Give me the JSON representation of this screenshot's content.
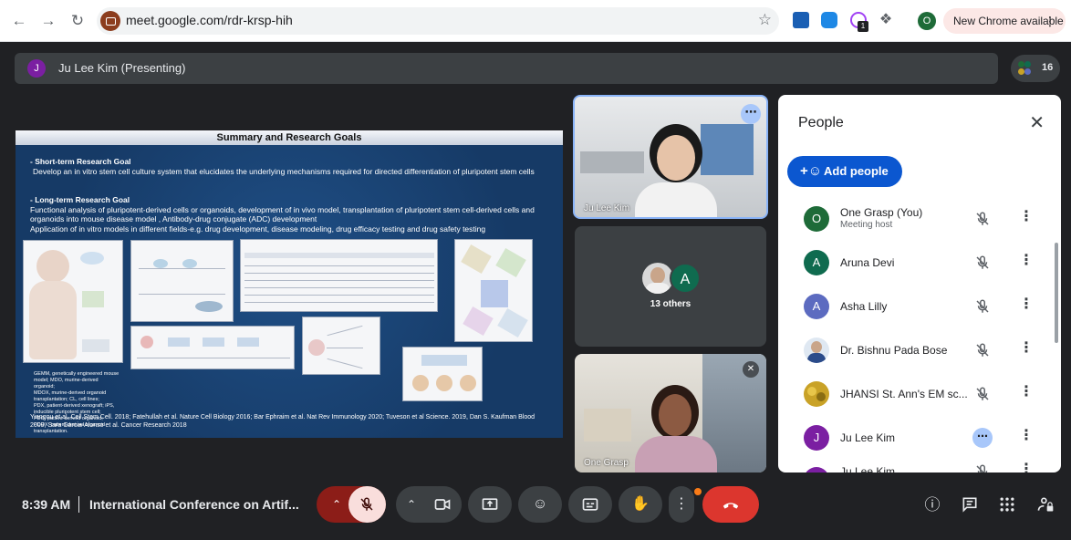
{
  "browser": {
    "url": "meet.google.com/rdr-krsp-hih",
    "profile_initial": "O",
    "update_label": "New Chrome available",
    "extension_badge": "1"
  },
  "meet": {
    "presenter_label": "Ju Lee Kim (Presenting)",
    "presenter_initial": "J",
    "participant_count": "16"
  },
  "slide": {
    "title": "Summary and Research Goals",
    "short_term_heading": "- Short-term Research Goal",
    "short_term_body": "Develop an in vitro stem cell culture system that elucidates the underlying mechanisms required for directed differentiation of pluripotent stem cells",
    "long_term_heading": "- Long-term Research Goal",
    "long_term_body": "Functional analysis of pluripotent-derived cells or organoids, development of  in vivo model, transplantation of pluripotent stem cell-derived cells and organoids into mouse disease model , Antibody-drug conjugate (ADC) development",
    "application": "Application of in vitro models in different fields-e.g. drug development, disease modeling, drug efficacy testing and drug safety testing",
    "abbrev": [
      "GEMM, genetically engineered mouse model; MDO, murine-derived",
      "organoid;",
      "MDOX, murine-derived organoid transplantation; CL, cell lines;",
      "PDX, patient-derived xenograft; iPS, inducible pluripotent stem cell;",
      "PDO, patient-derived organoid;",
      "PDOX, patient-derived organoid transplantation."
    ],
    "references": "Yiangou et al. Cell Stem Cell. 2018; Fatehullah et al. Nature Cell Biology 2016; Bar Ephraim et al.  Nat Rev Immunology 2020; Tuveson et al Science. 2019, Dan S. Kaufman Blood 2009, Sara Garcia-Alonso  et al. Cancer Research 2018"
  },
  "tiles": {
    "speaker_name": "Ju Lee Kim",
    "others_initial": "A",
    "others_label": "13 others",
    "self_name": "One Grasp"
  },
  "people": {
    "title": "People",
    "add_label": "Add people",
    "list": [
      {
        "initial": "O",
        "name": "One Grasp (You)",
        "sub": "Meeting host",
        "color": "#1e6b38"
      },
      {
        "initial": "A",
        "name": "Aruna Devi",
        "sub": "",
        "color": "#0f6b4f"
      },
      {
        "initial": "A",
        "name": "Asha Lilly",
        "sub": "",
        "color": "#5c6bc0"
      },
      {
        "initial": "",
        "name": "Dr. Bishnu Pada Bose",
        "sub": "",
        "color": "#3a6fb0"
      },
      {
        "initial": "",
        "name": "JHANSI St. Ann's EM sc...",
        "sub": "",
        "color": "#c9a227"
      },
      {
        "initial": "J",
        "name": "Ju Lee Kim",
        "sub": "",
        "color": "#7b1fa2"
      },
      {
        "initial": "J",
        "name": "Ju Lee Kim",
        "sub": "",
        "color": "#7b1fa2"
      }
    ]
  },
  "bottom": {
    "time": "8:39 AM",
    "meeting_title": "International Conference on Artif..."
  }
}
